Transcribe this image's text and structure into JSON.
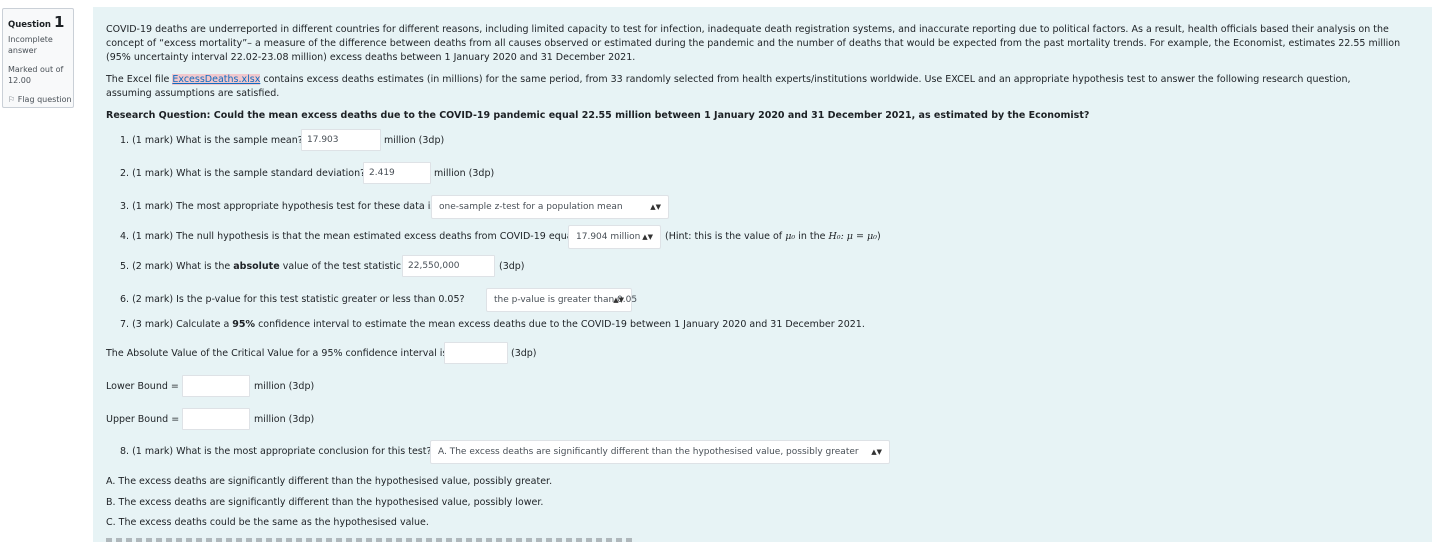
{
  "question_info": {
    "label": "Question",
    "number": "1",
    "state_line1": "Incomplete",
    "state_line2": "answer",
    "grade_line1": "Marked out of",
    "grade_line2": "12.00",
    "flag_label": "Flag question",
    "flag_icon": "flag-icon"
  },
  "intro": {
    "p1": "COVID-19 deaths are underreported in different countries for different reasons, including limited capacity to test for infection, inadequate death registration systems, and inaccurate reporting due to political factors. As a result, health officials based their analysis on the concept of “excess mortality”– a measure of the difference between deaths from all causes observed or estimated during the pandemic and the number of deaths that would be expected from the past mortality trends. For example, the Economist, estimates 22.55 million (95% uncertainty interval 22.02-23.08 million) excess deaths between 1 January 2020 and 31 December 2021.",
    "p2_before": "The Excel file ",
    "p2_link": "ExcessDeaths.xlsx",
    "p2_after": " contains excess deaths estimates (in millions) for the same period, from 33 randomly selected from health experts/institutions worldwide. Use EXCEL and an appropriate hypothesis test to answer the following research question, assuming assumptions are satisfied.",
    "research_question": "Research Question: Could the mean excess deaths due to the COVID-19 pandemic equal 22.55 million between 1 January 2020 and 31 December 2021, as estimated by the Economist?"
  },
  "items": {
    "q1_label": "1. (1 mark) What is the sample mean?",
    "q1_value": "17.903",
    "q1_unit": "million (3dp)",
    "q2_label": "2. (1 mark) What is the sample standard deviation?",
    "q2_value": "2.419",
    "q2_unit": "million (3dp)",
    "q3_label": "3. (1 mark) The most appropriate hypothesis test for these data is",
    "q3_selected": "one-sample z-test for a population mean",
    "q4_label": "4. (1 mark) The null hypothesis is that the mean estimated excess deaths from COVID-19 equal",
    "q4_selected": "17.904 million",
    "q4_hint_a": "(Hint: this is the value of ",
    "q4_hint_mu0": "μ₀",
    "q4_hint_b": " in the ",
    "q4_hint_h0": "H₀: μ = μ₀",
    "q4_hint_c": ")",
    "q5_label_a": "5. (2 mark) What is the ",
    "q5_label_bold": "absolute",
    "q5_label_b": " value of the test statistic ?",
    "q5_value": "22,550,000",
    "q5_unit": "(3dp)",
    "q6_label": "6. (2 mark) Is the p-value for this test statistic greater or less than 0.05?",
    "q6_selected": "the p-value is greater than 0.05",
    "q7_label_a": "7. (3 mark) Calculate a ",
    "q7_label_bold": "95%",
    "q7_label_b": " confidence interval to estimate the mean excess deaths due to the COVID-19 between 1 January 2020 and 31 December 2021.",
    "cv_label": "The Absolute Value of the Critical Value for a 95% confidence interval is",
    "cv_value": "",
    "cv_unit": "(3dp)",
    "lower_label": "Lower Bound =",
    "lower_value": "",
    "lower_unit": "million (3dp)",
    "upper_label": "Upper Bound =",
    "upper_value": "",
    "upper_unit": "million (3dp)",
    "q8_label": "8. (1 mark) What is the most appropriate conclusion for this test?",
    "q8_selected": "A. The excess deaths are significantly different than the hypothesised value, possibly greater",
    "option_a": "A. The excess deaths are significantly different than the hypothesised value, possibly greater.",
    "option_b": "B. The excess deaths are significantly different than the hypothesised value, possibly lower.",
    "option_c": "C. The excess deaths could be the same as the hypothesised value."
  },
  "colors": {
    "content_bg": "#e7f3f5",
    "info_bg": "#f8f9fa",
    "link": "#0f6cbf"
  }
}
